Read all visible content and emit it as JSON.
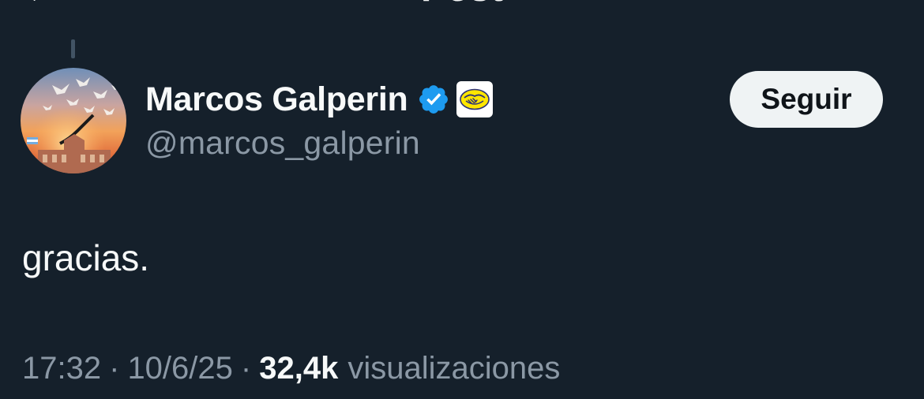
{
  "header": {
    "title": "Post"
  },
  "post": {
    "author": {
      "display_name": "Marcos Galperin",
      "handle": "@marcos_galperin",
      "verified": true,
      "verified_color": "#1d9bf0"
    },
    "follow_label": "Seguir",
    "text": "gracias.",
    "time": "17:32",
    "date": "10/6/25",
    "separator": "·",
    "views_count": "32,4k",
    "views_label": "visualizaciones"
  },
  "colors": {
    "background": "#15202b",
    "primary_text": "#f7f9f9",
    "secondary_text": "#8b98a5",
    "button_bg": "#eff3f4"
  }
}
